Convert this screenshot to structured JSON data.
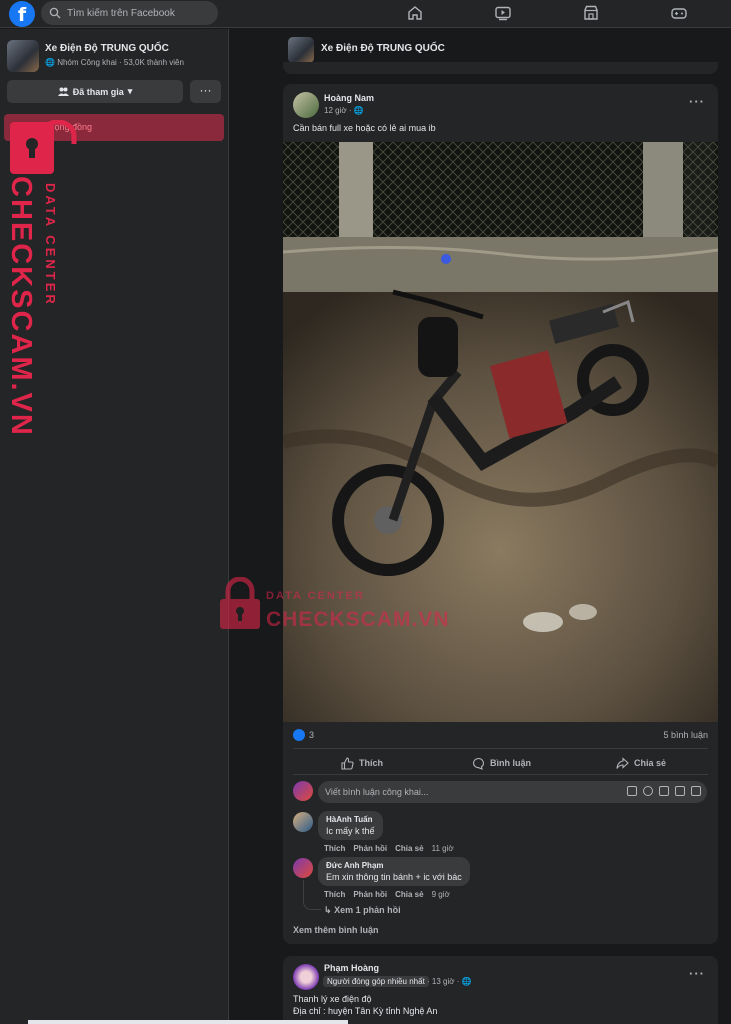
{
  "topbar": {
    "logo_letter": "f",
    "search_placeholder": "Tìm kiếm trên Facebook",
    "nav_icons": [
      "home-icon",
      "watch-icon",
      "marketplace-icon",
      "gaming-icon"
    ]
  },
  "sidebar": {
    "group_name": "Xe Điện Độ TRUNG QUỐC",
    "group_meta": "Nhóm Công khai · 53,0K thành viên",
    "joined_label": "Đã tham gia",
    "more_label": "···",
    "rules_label": "chủ của cộng đồng"
  },
  "watermark": {
    "brand": "CHECKSCAM.VN",
    "subtitle": "DATA CENTER"
  },
  "sticky": {
    "group_name": "Xe Điện Độ TRUNG QUỐC"
  },
  "post": {
    "author": "Hoàng Nam",
    "time": "12 giờ · ",
    "text": "Cần bán full xe hoặc có lẻ ai mua ib",
    "reaction_count": "3",
    "comment_count": "5 bình luận",
    "actions": {
      "like": "Thích",
      "comment": "Bình luận",
      "share": "Chia sẻ"
    },
    "comment_placeholder": "Viết bình luận công khai...",
    "comments": [
      {
        "name": "HàAnh Tuấn",
        "text": "Ic mấy k thế",
        "like": "Thích",
        "reply": "Phản hồi",
        "share": "Chia sẻ",
        "time": "11 giờ"
      },
      {
        "name": "Đức Anh Phạm",
        "text": "Em xin thông tin bánh + ic với bác",
        "like": "Thích",
        "reply": "Phản hồi",
        "share": "Chia sẻ",
        "time": "9 giờ",
        "replies_label": "Xem 1 phản hồi"
      }
    ],
    "more_comments": "Xem thêm bình luận",
    "colors": {
      "like_blue": "#1877f2",
      "card_bg": "#242526",
      "page_bg": "#18191a"
    }
  },
  "post2": {
    "author": "Phạm Hoàng",
    "badge": "Người đóng góp nhiều nhất",
    "time": "· 13 giờ · ",
    "line1": "Thanh lý xe điện độ",
    "line2": "Địa chỉ : huyện Tân Kỳ tỉnh Nghệ An"
  }
}
